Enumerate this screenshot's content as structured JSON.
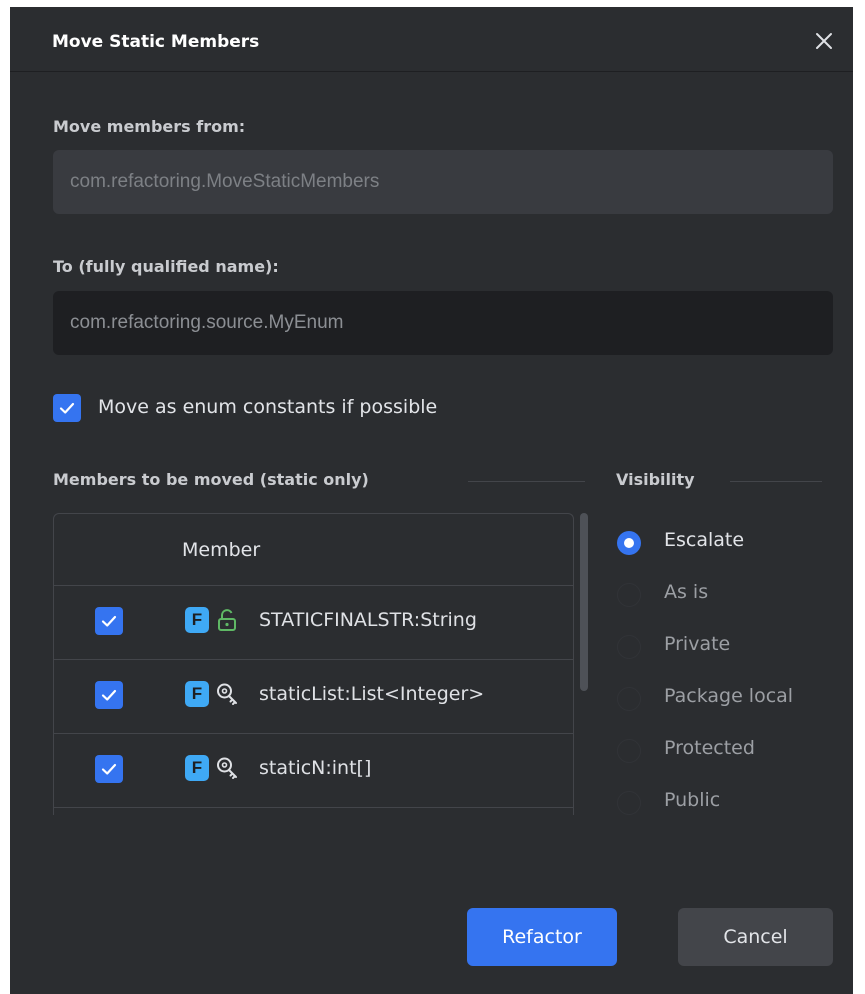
{
  "dialog": {
    "title": "Move Static Members",
    "close_icon": "close-icon"
  },
  "from": {
    "label": "Move members from:",
    "value": "com.refactoring.MoveStaticMembers"
  },
  "to": {
    "label": "To (fully qualified name):",
    "value": "com.refactoring.source.MyEnum"
  },
  "enum_option": {
    "label": "Move as enum constants if possible",
    "checked": true
  },
  "members": {
    "section_title": "Members to be moved (static only)",
    "column_header": "Member",
    "rows": [
      {
        "checked": true,
        "kind_badge": "F",
        "visibility_icon": "unlock-icon",
        "text": "STATICFINALSTR:String"
      },
      {
        "checked": true,
        "kind_badge": "F",
        "visibility_icon": "package-key-icon",
        "text": "staticList:List<Integer>"
      },
      {
        "checked": true,
        "kind_badge": "F",
        "visibility_icon": "package-key-icon",
        "text": "staticN:int[]"
      }
    ]
  },
  "visibility": {
    "section_title": "Visibility",
    "options": [
      {
        "label": "Escalate",
        "selected": true
      },
      {
        "label": "As is",
        "selected": false
      },
      {
        "label": "Private",
        "selected": false
      },
      {
        "label": "Package local",
        "selected": false
      },
      {
        "label": "Protected",
        "selected": false
      },
      {
        "label": "Public",
        "selected": false
      }
    ]
  },
  "buttons": {
    "refactor": "Refactor",
    "cancel": "Cancel"
  },
  "colors": {
    "background": "#2b2d30",
    "accent": "#3574f0",
    "field_badge": "#3fa9f5",
    "unlock_green": "#5fb865"
  }
}
